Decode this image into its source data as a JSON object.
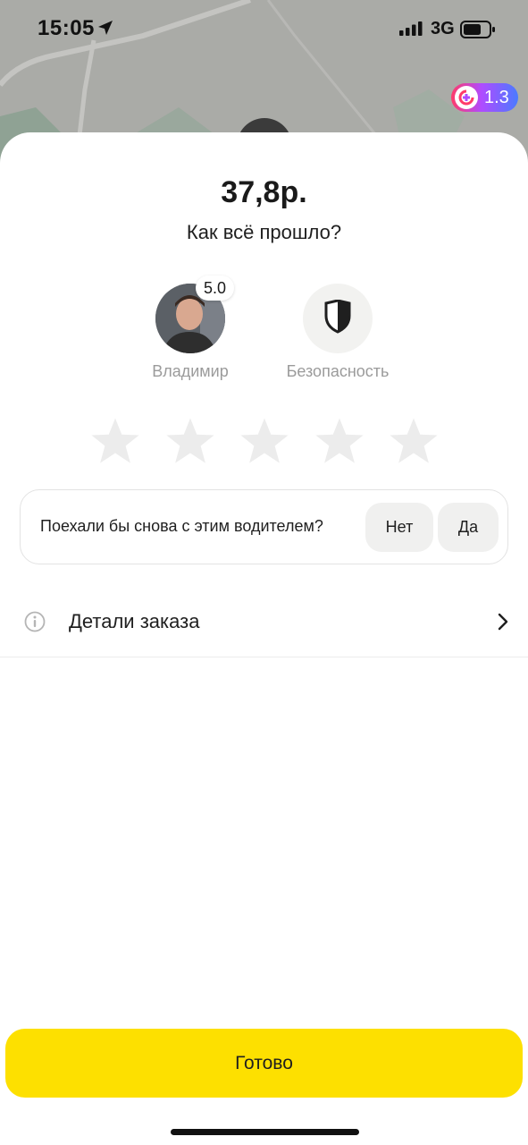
{
  "status_bar": {
    "time": "15:05",
    "network": "3G",
    "icons": [
      "location-arrow-icon",
      "signal-bars-icon",
      "battery-icon"
    ]
  },
  "plus_badge": {
    "value": "1.3",
    "icon": "plus-cashback-icon"
  },
  "ride": {
    "price": "37,8р.",
    "question": "Как всё прошло?"
  },
  "driver": {
    "name": "Владимир",
    "rating": "5.0"
  },
  "safety": {
    "label": "Безопасность",
    "icon": "shield-icon"
  },
  "rating_stars": {
    "count": 5,
    "selected": 0,
    "color_empty": "#ececec"
  },
  "again": {
    "question": "Поехали бы снова с этим водителем?",
    "no_label": "Нет",
    "yes_label": "Да"
  },
  "details": {
    "label": "Детали заказа",
    "icon": "info-icon"
  },
  "done_button": {
    "label": "Готово",
    "color": "#fde000"
  }
}
